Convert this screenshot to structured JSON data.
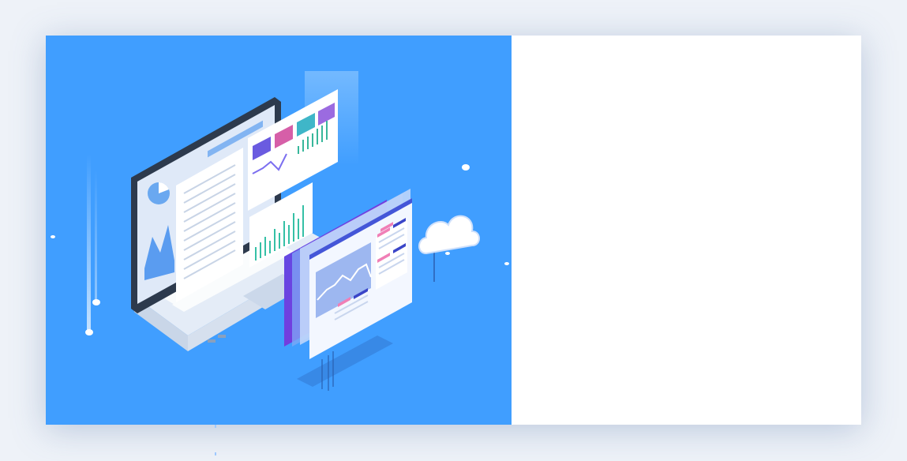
{
  "colors": {
    "page_background": "#eef2f8",
    "hero_background": "#409eff",
    "panel_background": "#ffffff",
    "accent_pink": "#f07fb6",
    "accent_purple": "#6a3bd8",
    "accent_navy": "#3a45c8",
    "laptop_dark": "#2d3a4d"
  },
  "illustration": {
    "name": "isometric-laptop-dashboard-illustration",
    "icons": [
      "laptop-icon",
      "cloud-icon",
      "dashboard-screen-icon",
      "bar-chart-icon",
      "area-chart-icon",
      "pie-chart-icon"
    ]
  },
  "right_panel": {
    "content": ""
  }
}
